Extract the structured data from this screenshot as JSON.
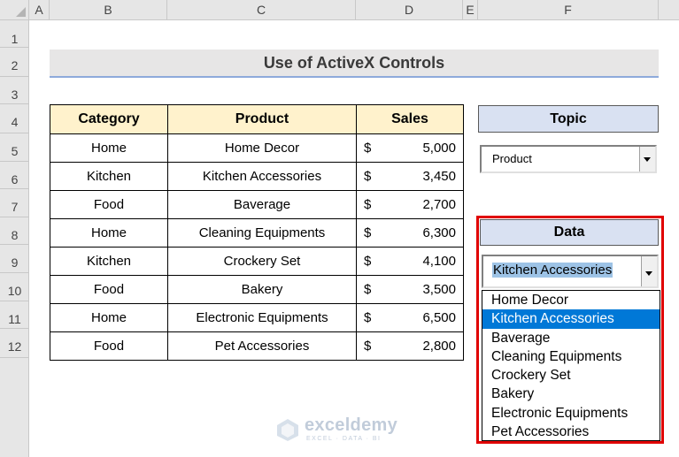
{
  "sheet": {
    "columns": [
      "A",
      "B",
      "C",
      "D",
      "E",
      "F"
    ],
    "rows": [
      "1",
      "2",
      "3",
      "4",
      "5",
      "6",
      "7",
      "8",
      "9",
      "10",
      "11",
      "12"
    ]
  },
  "title": "Use of ActiveX Controls",
  "table": {
    "headers": [
      "Category",
      "Product",
      "Sales"
    ],
    "currency": "$",
    "rows": [
      {
        "category": "Home",
        "product": "Home Decor",
        "sales": "5,000"
      },
      {
        "category": "Kitchen",
        "product": "Kitchen Accessories",
        "sales": "3,450"
      },
      {
        "category": "Food",
        "product": "Baverage",
        "sales": "2,700"
      },
      {
        "category": "Home",
        "product": "Cleaning Equipments",
        "sales": "6,300"
      },
      {
        "category": "Kitchen",
        "product": "Crockery Set",
        "sales": "4,100"
      },
      {
        "category": "Food",
        "product": "Bakery",
        "sales": "3,500"
      },
      {
        "category": "Home",
        "product": "Electronic Equipments",
        "sales": "6,500"
      },
      {
        "category": "Food",
        "product": "Pet Accessories",
        "sales": "2,800"
      }
    ]
  },
  "topic": {
    "label": "Topic",
    "selected": "Product"
  },
  "data_control": {
    "label": "Data",
    "selected": "Kitchen Accessories",
    "options": [
      "Home Decor",
      "Kitchen Accessories",
      "Baverage",
      "Cleaning Equipments",
      "Crockery Set",
      "Bakery",
      "Electronic Equipments",
      "Pet Accessories"
    ],
    "highlighted_index": 1
  },
  "watermark": {
    "name": "exceldemy",
    "tagline": "EXCEL · DATA · BI"
  },
  "colors": {
    "header_fill": "#fff2cc",
    "control_label_fill": "#d9e1f2",
    "highlight": "#0078d7",
    "frame": "#e00000"
  }
}
